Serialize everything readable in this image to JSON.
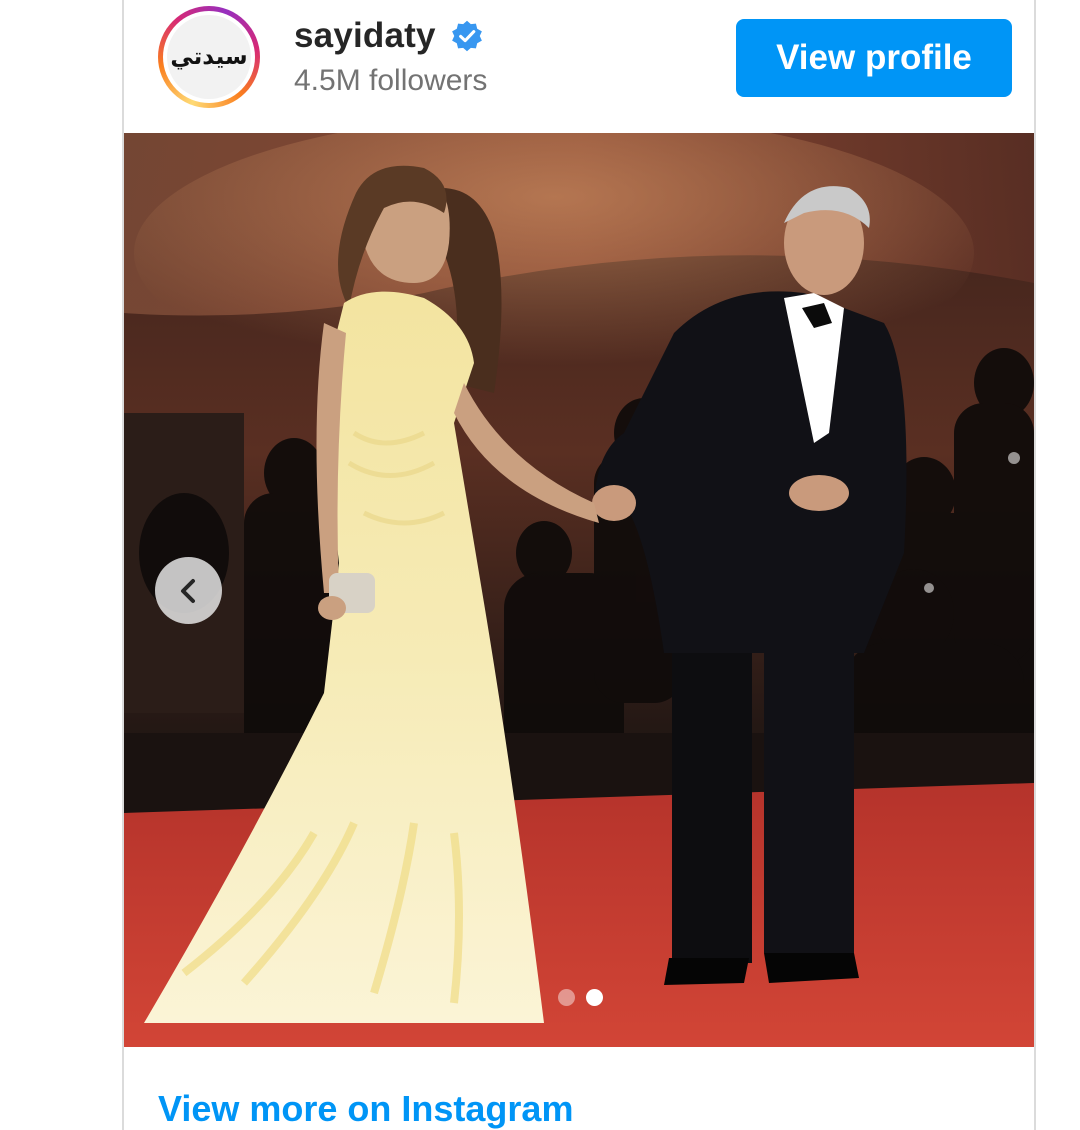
{
  "post": {
    "account": {
      "username": "sayidaty",
      "followers": "4.5M followers",
      "avatar_logo_text": "سيدتي",
      "verified": true
    },
    "view_profile_label": "View profile",
    "carousel": {
      "slide_count": 2,
      "active_slide": 2,
      "prev_icon": "chevron-left-icon"
    },
    "view_more_label": "View more on Instagram"
  },
  "colors": {
    "accent": "#0095f6",
    "verified": "#3897f0",
    "text_primary": "#262626",
    "text_secondary": "#737373",
    "carpet": "#c43a30"
  }
}
